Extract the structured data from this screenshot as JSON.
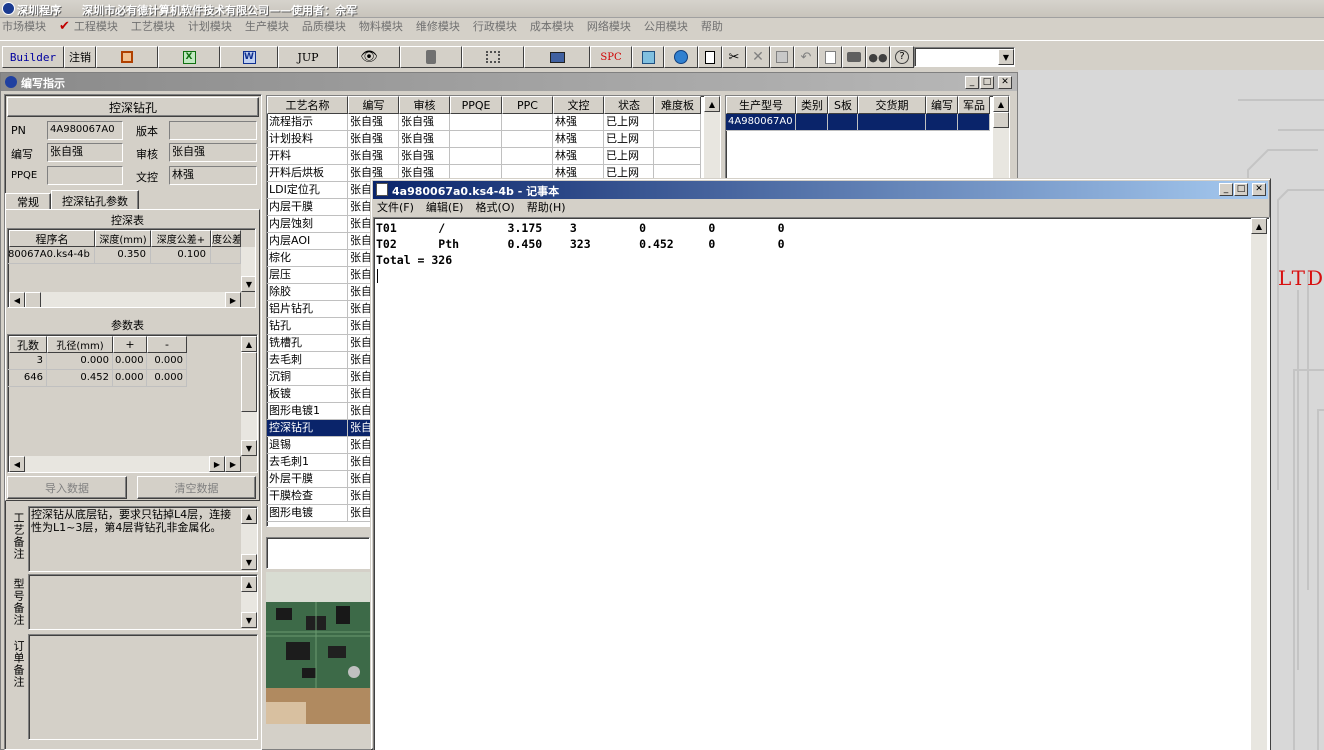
{
  "app": {
    "title": "深圳程序",
    "company": "深圳市必有德计算机软件技术有限公司——使用者：佘军"
  },
  "menu": [
    "市场模块",
    "工程模块",
    "工艺模块",
    "计划模块",
    "生产模块",
    "品质模块",
    "物料模块",
    "维修模块",
    "行政模块",
    "成本模块",
    "网络模块",
    "公用模块",
    "帮助"
  ],
  "toolbar": {
    "builder": "Builder",
    "logout": "注销",
    "jup": "JUP",
    "spc": "SPC"
  },
  "main_window": {
    "title": "编写指示"
  },
  "left": {
    "section_title": "控深钻孔",
    "pn_label": "PN",
    "pn_value": "4A980067A0",
    "version_label": "版本",
    "version_value": "",
    "writer_label": "编写",
    "writer_value": "张自强",
    "review_label": "审核",
    "review_value": "张自强",
    "ppqe_label": "PPQE",
    "ppqe_value": "",
    "doc_label": "文控",
    "doc_value": "林强",
    "tabs": [
      "常规",
      "控深钻孔参数"
    ],
    "depth_table": {
      "title": "控深表",
      "headers": [
        "程序名",
        "深度(mm)",
        "深度公差+",
        "度公差"
      ],
      "rows": [
        [
          "80067A0.ks4-4b",
          "0.350",
          "0.100",
          ""
        ]
      ]
    },
    "param_table": {
      "title": "参数表",
      "headers": [
        "孔数",
        "孔径(mm)",
        "+",
        "-"
      ],
      "rows": [
        [
          "3",
          "0.000",
          "0.000",
          "0.000"
        ],
        [
          "646",
          "0.452",
          "0.000",
          "0.000"
        ]
      ]
    },
    "import_btn": "导入数据",
    "clear_btn": "清空数据",
    "notes": [
      {
        "label": "工艺备注",
        "text": "控深钻从底层钻，要求只钻掉L4层，连接性为L1~3层，第4层背钻孔非金属化。"
      },
      {
        "label": "型号备注",
        "text": ""
      },
      {
        "label": "订单备注",
        "text": ""
      }
    ]
  },
  "process": {
    "headers": [
      "工艺名称",
      "编写",
      "审核",
      "PPQE",
      "PPC",
      "文控",
      "状态",
      "难度板"
    ],
    "rows": [
      [
        "流程指示",
        "张自强",
        "张自强",
        "",
        "",
        "林强",
        "已上网",
        ""
      ],
      [
        "计划投料",
        "张自强",
        "张自强",
        "",
        "",
        "林强",
        "已上网",
        ""
      ],
      [
        "开料",
        "张自强",
        "张自强",
        "",
        "",
        "林强",
        "已上网",
        ""
      ],
      [
        "开料后烘板",
        "张自强",
        "张自强",
        "",
        "",
        "林强",
        "已上网",
        ""
      ],
      [
        "LDI定位孔",
        "张自强"
      ],
      [
        "内层干膜",
        "张自强"
      ],
      [
        "内层蚀刻",
        "张自强"
      ],
      [
        "内层AOI",
        "张自强"
      ],
      [
        "棕化",
        "张自强"
      ],
      [
        "层压",
        "张自强"
      ],
      [
        "除胶",
        "张自强"
      ],
      [
        "铝片钻孔",
        "张自强"
      ],
      [
        "钻孔",
        "张自强"
      ],
      [
        "铣槽孔",
        "张自强"
      ],
      [
        "去毛刺",
        "张自强"
      ],
      [
        "沉铜",
        "张自强"
      ],
      [
        "板镀",
        "张自强"
      ],
      [
        "图形电镀1",
        "张自强"
      ],
      [
        "控深钻孔",
        "张自强"
      ],
      [
        "退锡",
        "张自强"
      ],
      [
        "去毛刺1",
        "张自强"
      ],
      [
        "外层干膜",
        "张自强"
      ],
      [
        "干膜检查",
        "张自强"
      ],
      [
        "图形电镀",
        "张自强"
      ]
    ],
    "selected_row": 18
  },
  "product": {
    "headers": [
      "生产型号",
      "类别",
      "S板",
      "交货期",
      "编写",
      "军品"
    ],
    "rows": [
      [
        "4A980067A0",
        "",
        "",
        "",
        "",
        ""
      ]
    ]
  },
  "notepad": {
    "title": "4a980067a0.ks4-4b - 记事本",
    "menu": [
      "文件(F)",
      "编辑(E)",
      "格式(O)",
      "帮助(H)"
    ],
    "lines": [
      "T01      /         3.175    3         0         0         0",
      "T02      Pth       0.450    323       0.452     0         0",
      "Total = 326"
    ]
  },
  "background_text": "LTD"
}
